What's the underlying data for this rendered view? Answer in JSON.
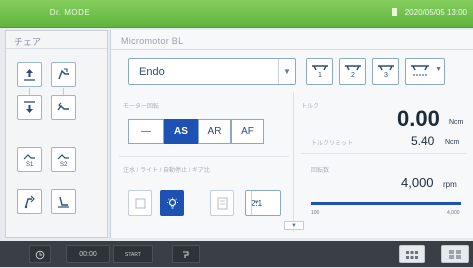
{
  "topbar": {
    "mode": "Dr. MODE",
    "status": "2020/05/05 13:00",
    "icons": [
      "battery-icon"
    ]
  },
  "chair": {
    "title": "チェア",
    "buttons": [
      "chair-up-icon",
      "backrest-up-icon",
      "chair-down-icon",
      "backrest-down-icon",
      "preset-s1-icon",
      "preset-s2-icon",
      "rinse-position-icon",
      "return-position-icon"
    ]
  },
  "main": {
    "title": "Micromotor BL",
    "program": "Endo",
    "file_buttons": [
      "1",
      "2",
      "3",
      ""
    ],
    "file_icons": [
      "file-1-icon",
      "file-2-icon",
      "file-3-icon",
      "file-select-icon"
    ],
    "mode_label": "モーター回転",
    "modes": [
      "—",
      "AS",
      "AR",
      "AF"
    ],
    "active_mode": "AS",
    "options_label": "注水 / ライト / 自動停止 / ギア比",
    "ratio": "2:1",
    "torque_label": "トルク",
    "torque_value": "0.00",
    "torque_unit": "Ncm",
    "torque_limit_label": "トルクリミット",
    "torque_limit_value": "5.40",
    "torque_limit_unit": "Ncm",
    "speed_label": "回転数",
    "speed_value": "4,000",
    "speed_unit": "rpm",
    "speed_fraction": 1.0,
    "speed_min": "100",
    "speed_max": "4,000"
  },
  "bottombar": {
    "timer_icon": "timer-icon",
    "time": "00:00",
    "start": "START",
    "handpiece_icon": "handpiece-icon",
    "grid_icon": "grid-icon",
    "menu_icon": "menu-icon"
  },
  "colors": {
    "topbar": "#5fb43d",
    "accent": "#1d52b4",
    "bottombar": "#3a3f45"
  }
}
